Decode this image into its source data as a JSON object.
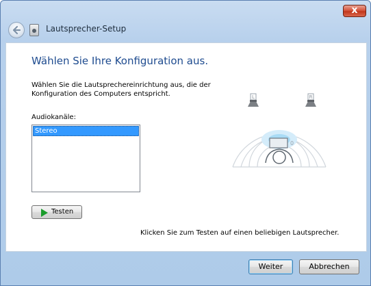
{
  "window": {
    "title": "Lautsprecher-Setup",
    "close_label": "x"
  },
  "main": {
    "heading": "Wählen Sie Ihre Konfiguration aus.",
    "description": "Wählen Sie die Lautsprechereinrichtung aus, die der Konfiguration des Computers entspricht.",
    "channels_label": "Audiokanäle:",
    "channels": [
      "Stereo"
    ],
    "selected_channel": "Stereo",
    "test_button": "Testen",
    "hint": "Klicken Sie zum Testen auf einen beliebigen Lautsprecher.",
    "speakers": {
      "left": "L",
      "right": "R"
    }
  },
  "footer": {
    "next": "Weiter",
    "cancel": "Abbrechen"
  }
}
